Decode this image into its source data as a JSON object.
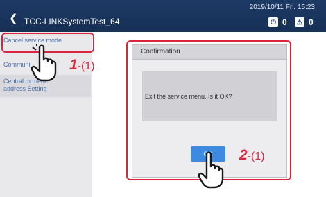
{
  "header": {
    "back_icon": "chevron-left-icon",
    "title": "TCC-LINKSystemTest_64",
    "datetime": "2019/10/11 Fri. 15:23",
    "indicator_power": {
      "icon": "power-icon",
      "count": "0"
    },
    "indicator_alert": {
      "icon": "alert-icon",
      "count": "0"
    }
  },
  "sidebar": {
    "items": [
      {
        "label": "Cancel service mode"
      },
      {
        "label": "Communi"
      },
      {
        "label_line1": "Central m   ment",
        "label_line2": "address Setting"
      }
    ]
  },
  "dialog": {
    "title": "Confirmation",
    "message": "Exit the service menu. Is it OK?",
    "ok_label": "OK"
  },
  "annotations": {
    "step1_number": "1",
    "step1_suffix": "-(1)",
    "step2_number": "2",
    "step2_suffix": "-(1)"
  },
  "colors": {
    "header_bg": "#1d3a66",
    "highlight_red": "#d7263d",
    "ok_button": "#3d8be0",
    "sidebar_text": "#4a6fa8"
  }
}
